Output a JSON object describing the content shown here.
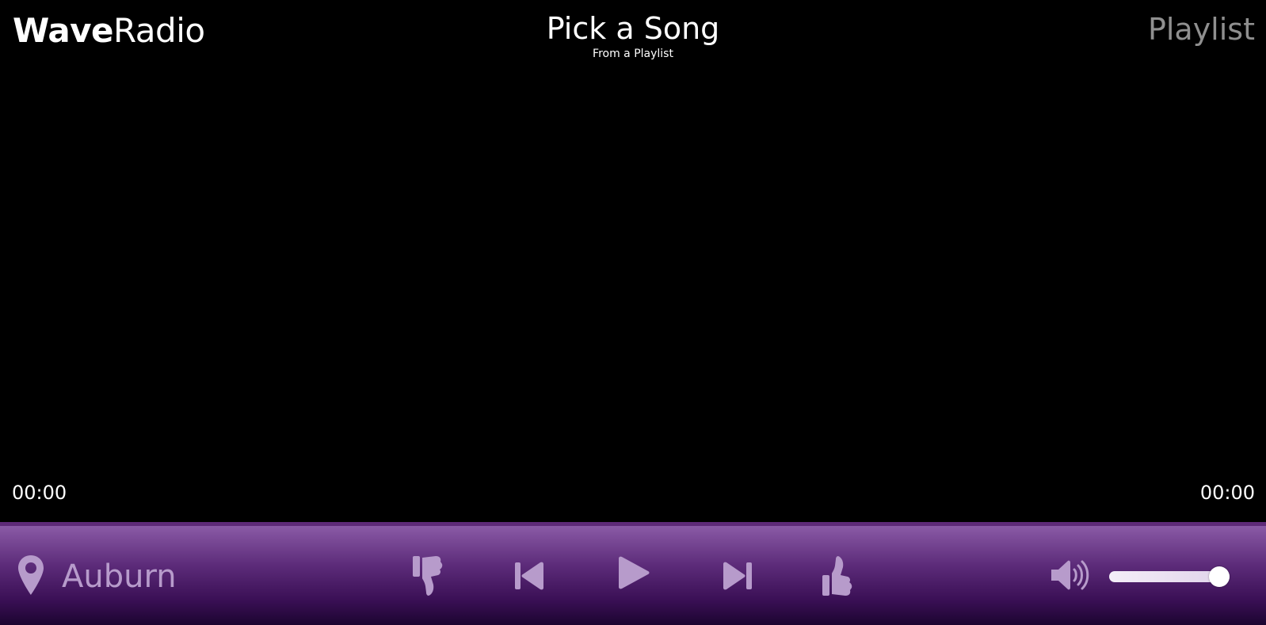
{
  "header": {
    "logo_bold": "Wave",
    "logo_regular": "Radio",
    "song_title": "Pick a Song",
    "song_subtitle": "From a Playlist",
    "playlist_link": "Playlist"
  },
  "timeline": {
    "elapsed": "00:00",
    "duration": "00:00"
  },
  "player": {
    "location": "Auburn",
    "volume_fraction": 1.0,
    "icons": {
      "location": "map-pin-icon",
      "dislike": "thumbs-down-icon",
      "previous": "skip-back-icon",
      "play": "play-icon",
      "next": "skip-forward-icon",
      "like": "thumbs-up-icon",
      "volume": "volume-high-icon"
    }
  },
  "colors": {
    "background": "#000000",
    "bar_top": "#8a5aa6",
    "bar_bottom": "#1c0530",
    "icon": "#b79bcb",
    "playlist_link": "#8f8f8f"
  }
}
